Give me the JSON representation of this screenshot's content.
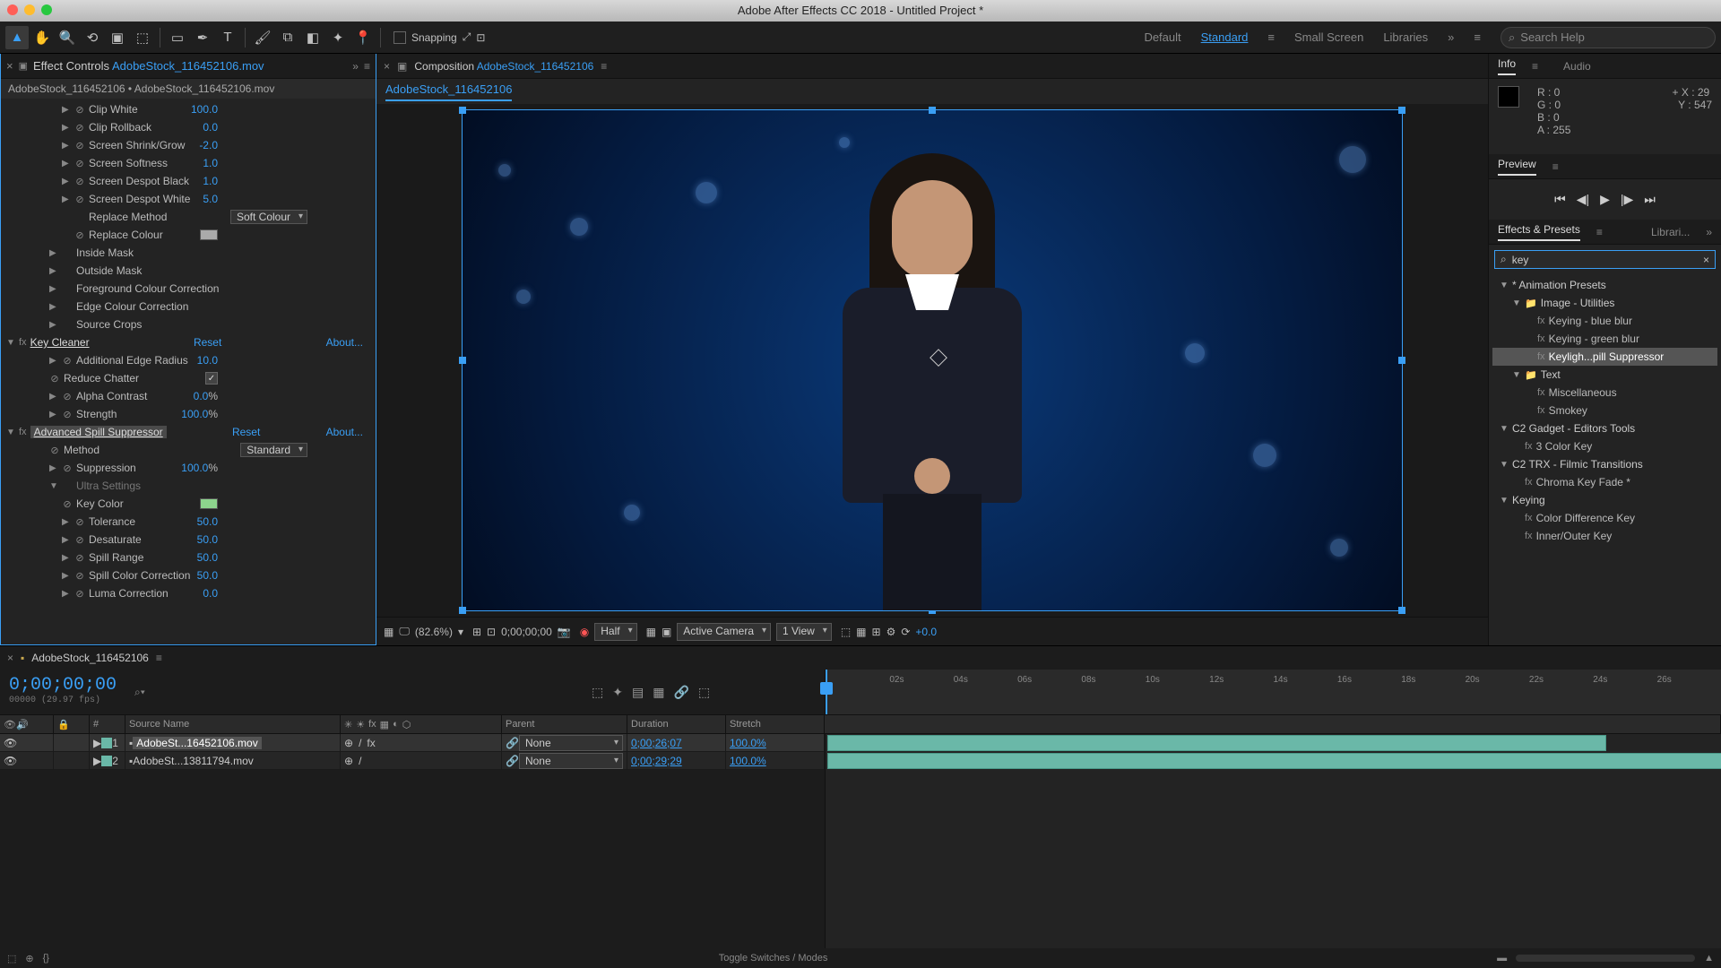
{
  "title": "Adobe After Effects CC 2018 - Untitled Project *",
  "toolbar": {
    "snapping_label": "Snapping",
    "workspaces": [
      "Default",
      "Standard",
      "Small Screen",
      "Libraries"
    ],
    "active_ws": "Standard",
    "search_placeholder": "Search Help"
  },
  "effect_controls": {
    "tab_prefix": "Effect Controls",
    "tab_name": "AdobeStock_116452106.mov",
    "breadcrumb": "AdobeStock_116452106 • AdobeStock_116452106.mov",
    "props": [
      {
        "ind": 3,
        "tri": "▶",
        "stop": true,
        "label": "Clip White",
        "val": "100.0"
      },
      {
        "ind": 3,
        "tri": "▶",
        "stop": true,
        "label": "Clip Rollback",
        "val": "0.0"
      },
      {
        "ind": 3,
        "tri": "▶",
        "stop": true,
        "label": "Screen Shrink/Grow",
        "val": "-2.0"
      },
      {
        "ind": 3,
        "tri": "▶",
        "stop": true,
        "label": "Screen Softness",
        "val": "1.0"
      },
      {
        "ind": 3,
        "tri": "▶",
        "stop": true,
        "label": "Screen Despot Black",
        "val": "1.0"
      },
      {
        "ind": 3,
        "tri": "▶",
        "stop": true,
        "label": "Screen Despot White",
        "val": "5.0"
      },
      {
        "ind": 3,
        "tri": "",
        "stop": false,
        "label": "Replace Method",
        "dd": "Soft Colour"
      },
      {
        "ind": 3,
        "tri": "",
        "stop": true,
        "label": "Replace Colour",
        "swatch": "#aaaaaa"
      },
      {
        "ind": 2,
        "tri": "▶",
        "label": "Inside Mask"
      },
      {
        "ind": 2,
        "tri": "▶",
        "label": "Outside Mask"
      },
      {
        "ind": 2,
        "tri": "▶",
        "label": "Foreground Colour Correction"
      },
      {
        "ind": 2,
        "tri": "▶",
        "label": "Edge Colour Correction"
      },
      {
        "ind": 2,
        "tri": "▶",
        "label": "Source Crops"
      }
    ],
    "key_cleaner": {
      "name": "Key Cleaner",
      "reset": "Reset",
      "about": "About...",
      "props": [
        {
          "label": "Additional Edge Radius",
          "val": "10.0",
          "tri": "▶",
          "stop": true
        },
        {
          "label": "Reduce Chatter",
          "chk": true,
          "stop": true
        },
        {
          "label": "Alpha Contrast",
          "val": "0.0",
          "pct": "%",
          "tri": "▶",
          "stop": true
        },
        {
          "label": "Strength",
          "val": "100.0",
          "pct": "%",
          "tri": "▶",
          "stop": true
        }
      ]
    },
    "adv_spill": {
      "name": "Advanced Spill Suppressor",
      "reset": "Reset",
      "about": "About...",
      "props": [
        {
          "label": "Method",
          "dd": "Standard",
          "stop": true
        },
        {
          "label": "Suppression",
          "val": "100.0",
          "pct": "%",
          "tri": "▶",
          "stop": true
        },
        {
          "label": "Ultra Settings",
          "tri": "▼",
          "dim": true
        },
        {
          "ind": 1,
          "label": "Key Color",
          "swatch": "#8dd48d",
          "stop": true
        },
        {
          "ind": 1,
          "label": "Tolerance",
          "val": "50.0",
          "tri": "▶",
          "stop": true
        },
        {
          "ind": 1,
          "label": "Desaturate",
          "val": "50.0",
          "tri": "▶",
          "stop": true
        },
        {
          "ind": 1,
          "label": "Spill Range",
          "val": "50.0",
          "tri": "▶",
          "stop": true
        },
        {
          "ind": 1,
          "label": "Spill Color Correction",
          "val": "50.0",
          "tri": "▶",
          "stop": true
        },
        {
          "ind": 1,
          "label": "Luma Correction",
          "val": "0.0",
          "tri": "▶",
          "stop": true
        }
      ]
    }
  },
  "composition": {
    "tab_prefix": "Composition",
    "tab_name": "AdobeStock_116452106",
    "sub_tab": "AdobeStock_116452106",
    "zoom": "(82.6%)",
    "timecode": "0;00;00;00",
    "res": "Half",
    "camera": "Active Camera",
    "view": "1 View",
    "exposure": "+0.0"
  },
  "info": {
    "tabs": [
      "Info",
      "Audio"
    ],
    "R": "0",
    "G": "0",
    "B": "0",
    "A": "255",
    "X": "29",
    "Y": "547"
  },
  "preview": {
    "tab": "Preview"
  },
  "effects_presets": {
    "tabs": [
      "Effects & Presets",
      "Librari..."
    ],
    "search": "key",
    "tree": [
      {
        "t": "grp",
        "tri": "▼",
        "label": "* Animation Presets"
      },
      {
        "t": "grp",
        "tri": "▼",
        "ind": 1,
        "fld": true,
        "label": "Image - Utilities"
      },
      {
        "t": "item",
        "ind": 2,
        "fx": true,
        "label": "Keying - blue blur"
      },
      {
        "t": "item",
        "ind": 2,
        "fx": true,
        "label": "Keying - green blur"
      },
      {
        "t": "item",
        "ind": 2,
        "fx": true,
        "label": "Keyligh...pill Suppressor",
        "sel": true
      },
      {
        "t": "grp",
        "tri": "▼",
        "ind": 1,
        "fld": true,
        "label": "Text"
      },
      {
        "t": "item",
        "ind": 2,
        "fx": true,
        "label": "Miscellaneous"
      },
      {
        "t": "item",
        "ind": 2,
        "fx": true,
        "label": "Smokey"
      },
      {
        "t": "grp",
        "tri": "▼",
        "label": "C2 Gadget - Editors Tools"
      },
      {
        "t": "item",
        "ind": 1,
        "fx": true,
        "label": "3 Color Key"
      },
      {
        "t": "grp",
        "tri": "▼",
        "label": "C2 TRX - Filmic Transitions"
      },
      {
        "t": "item",
        "ind": 1,
        "fx": true,
        "label": "Chroma Key Fade *"
      },
      {
        "t": "grp",
        "tri": "▼",
        "label": "Keying"
      },
      {
        "t": "item",
        "ind": 1,
        "fx": true,
        "label": "Color Difference Key"
      },
      {
        "t": "item",
        "ind": 1,
        "fx": true,
        "label": "Inner/Outer Key"
      }
    ]
  },
  "timeline": {
    "tab": "AdobeStock_116452106",
    "timecode": "0;00;00;00",
    "frames": "00000 (29.97 fps)",
    "cols": {
      "num": "#",
      "src": "Source Name",
      "parent": "Parent",
      "dur": "Duration",
      "str": "Stretch"
    },
    "ticks": [
      "02s",
      "04s",
      "06s",
      "08s",
      "10s",
      "12s",
      "14s",
      "16s",
      "18s",
      "20s",
      "22s",
      "24s",
      "26s"
    ],
    "layers": [
      {
        "n": "1",
        "src": "AdobeSt...16452106.mov",
        "sel": true,
        "fx": true,
        "parent": "None",
        "dur": "0;00;26;07",
        "str": "100.0%",
        "len": 0.87
      },
      {
        "n": "2",
        "src": "AdobeSt...13811794.mov",
        "sel": false,
        "fx": false,
        "parent": "None",
        "dur": "0;00;29;29",
        "str": "100.0%",
        "len": 1.0
      }
    ],
    "footer": "Toggle Switches / Modes"
  }
}
